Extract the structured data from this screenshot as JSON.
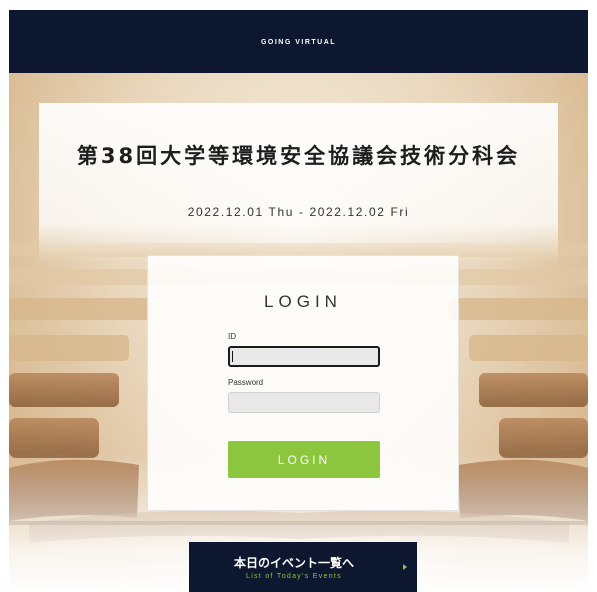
{
  "header": {
    "title": "GOING VIRTUAL"
  },
  "event": {
    "title": "第38回大学等環境安全協議会技術分科会",
    "dates": "2022.12.01 Thu - 2022.12.02 Fri"
  },
  "login": {
    "heading": "LOGIN",
    "id_label": "ID",
    "id_value": "",
    "password_label": "Password",
    "password_value": "",
    "button_label": "LOGIN"
  },
  "events_link": {
    "label_jp": "本日のイベント一覧へ",
    "label_en": "List of Today's Events",
    "icon": "triangle-right-icon"
  },
  "colors": {
    "navy": "#0d1830",
    "accent_green": "#8cc63f"
  }
}
